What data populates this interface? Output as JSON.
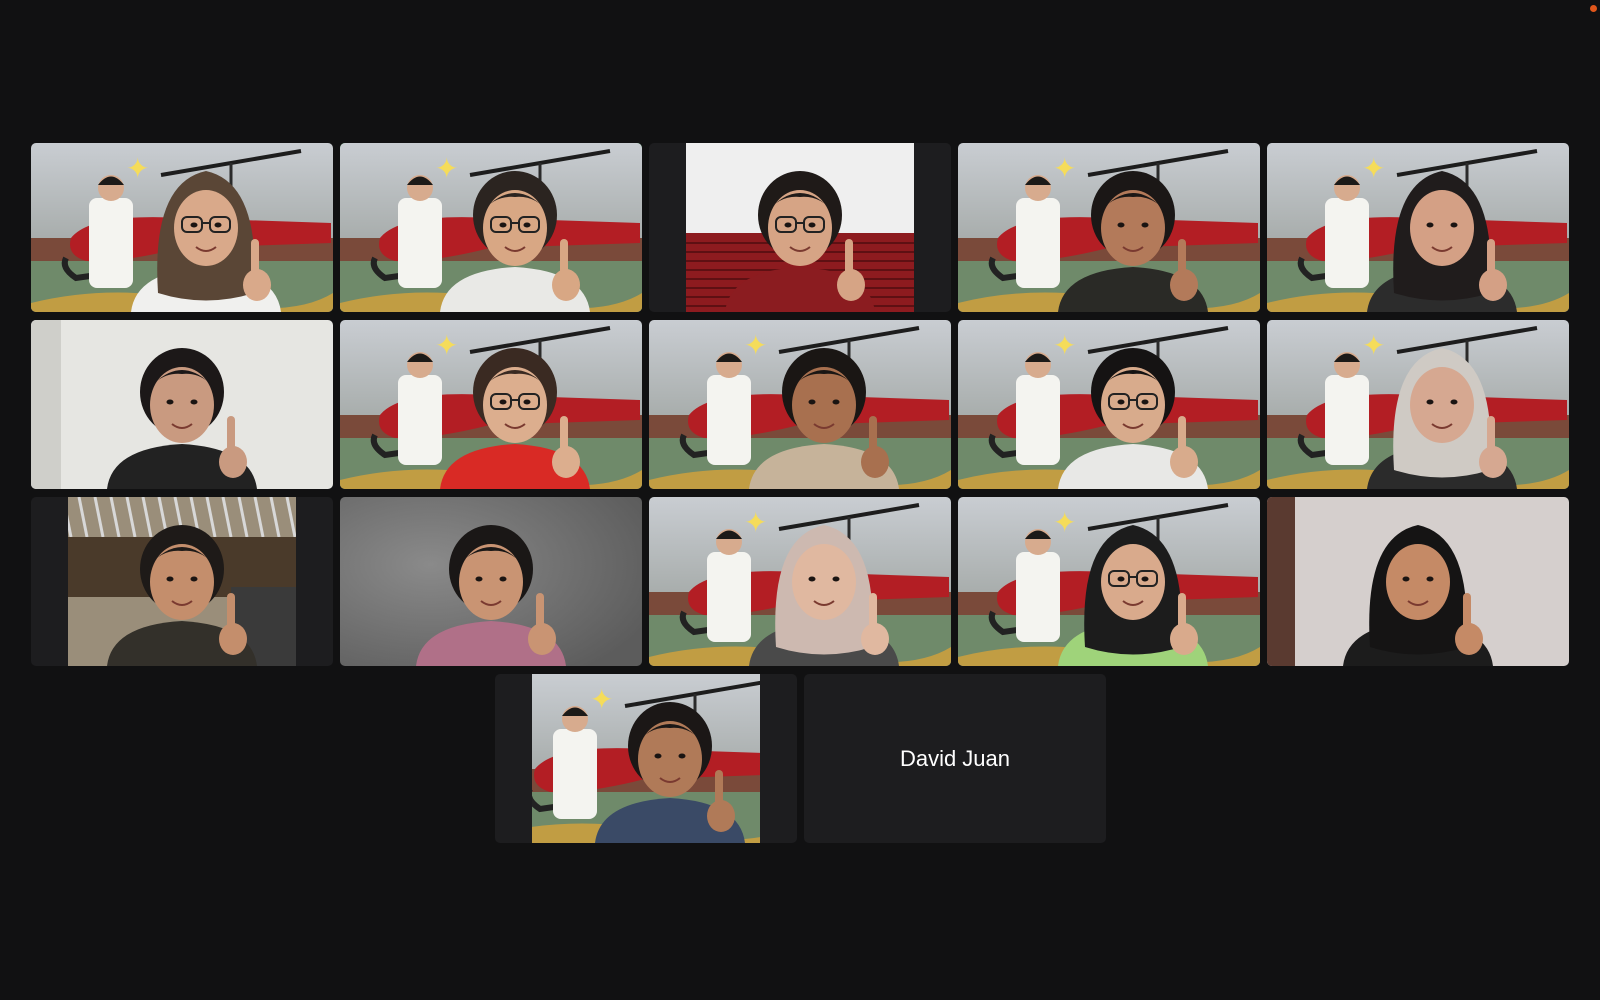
{
  "participants": [
    {
      "id": "p1",
      "background": "helicopter",
      "skin": "#d9a98a",
      "hair": "#5a4636",
      "shirt": "#f0f0ee",
      "hijab": true,
      "glasses": true
    },
    {
      "id": "p2",
      "background": "helicopter",
      "skin": "#d8a784",
      "hair": "#2b2420",
      "shirt": "#e9e9e6",
      "hijab": false,
      "glasses": true,
      "speaking": true
    },
    {
      "id": "p3",
      "background": "room-red-chair",
      "skin": "#d6a485",
      "hair": "#1f1a18",
      "shirt": "#8b1c20",
      "hijab": false,
      "glasses": true
    },
    {
      "id": "p4",
      "background": "helicopter",
      "skin": "#b37a5a",
      "hair": "#1b1716",
      "shirt": "#2a2a26",
      "hijab": false,
      "glasses": false
    },
    {
      "id": "p5",
      "background": "helicopter",
      "skin": "#d4a085",
      "hair": "#201c1c",
      "shirt": "#2c2c2c",
      "hijab": true,
      "glasses": false
    },
    {
      "id": "p6",
      "background": "room-white",
      "skin": "#c99a80",
      "hair": "#1c1818",
      "shirt": "#222222",
      "hijab": false,
      "glasses": false
    },
    {
      "id": "p7",
      "background": "helicopter",
      "skin": "#dcae8e",
      "hair": "#3a2a22",
      "shirt": "#d92a25",
      "hijab": false,
      "glasses": true
    },
    {
      "id": "p8",
      "background": "helicopter",
      "skin": "#a8704f",
      "hair": "#1a1614",
      "shirt": "#c6b39a",
      "hijab": false,
      "glasses": false
    },
    {
      "id": "p9",
      "background": "helicopter",
      "skin": "#d8ab8c",
      "hair": "#151313",
      "shirt": "#e8e8e6",
      "hijab": false,
      "glasses": true
    },
    {
      "id": "p10",
      "background": "helicopter",
      "skin": "#d6a891",
      "hair": "#cfcac4",
      "shirt": "#2b2b2b",
      "hijab": true,
      "glasses": false
    },
    {
      "id": "p11",
      "background": "room-ceiling",
      "skin": "#c48e6c",
      "hair": "#1e1a18",
      "shirt": "#33302a",
      "hijab": false,
      "glasses": false
    },
    {
      "id": "p12",
      "background": "room-grey",
      "skin": "#c99473",
      "hair": "#1a1716",
      "shirt": "#b07088",
      "hijab": false,
      "glasses": false
    },
    {
      "id": "p13",
      "background": "helicopter",
      "skin": "#e0b8a0",
      "hair": "#cdb9b0",
      "shirt": "#4a4a4a",
      "hijab": true,
      "glasses": false
    },
    {
      "id": "p14",
      "background": "helicopter",
      "skin": "#d9aa8c",
      "hair": "#1c1c1c",
      "shirt": "#9fd37a",
      "hijab": true,
      "glasses": true
    },
    {
      "id": "p15",
      "background": "room-wall",
      "skin": "#c58a66",
      "hair": "#151414",
      "shirt": "#1c1c1c",
      "hijab": true,
      "glasses": false
    },
    {
      "id": "p16",
      "background": "helicopter",
      "skin": "#b07a58",
      "hair": "#1b1716",
      "shirt": "#3a4a66",
      "hijab": false,
      "glasses": false
    },
    {
      "id": "p17",
      "name": "David Juan",
      "video_off": true
    }
  ],
  "recording_indicator_color": "#e0561b",
  "active_speaker_color": "#2fbf4b"
}
